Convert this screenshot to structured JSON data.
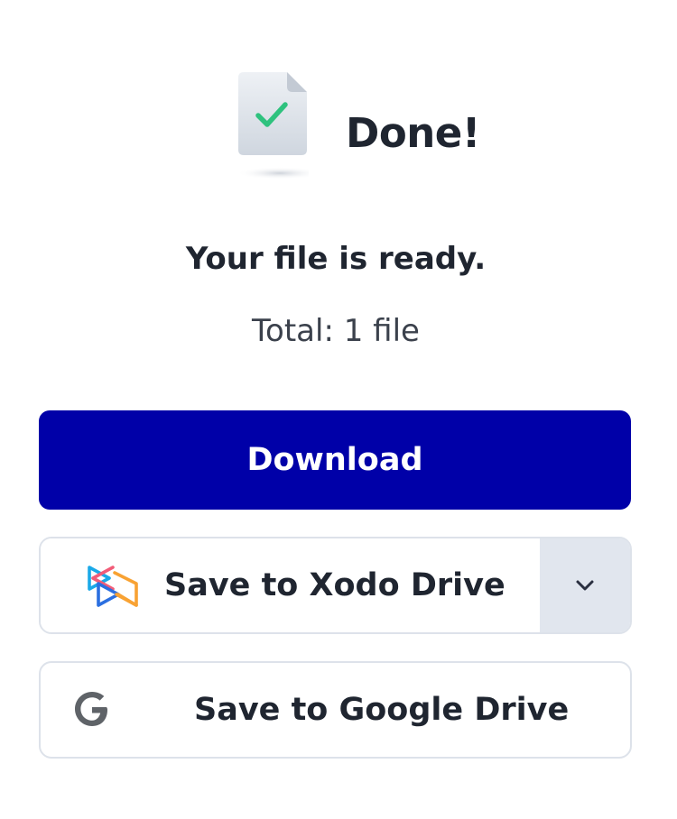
{
  "header": {
    "title": "Done!",
    "file_icon": "file-check-icon"
  },
  "status": {
    "message": "Your file is ready.",
    "total": "Total: 1 file"
  },
  "actions": {
    "download_label": "Download",
    "xodo_label": "Save to Xodo Drive",
    "xodo_icon": "xodo-drive-icon",
    "dropdown_icon": "chevron-down-icon",
    "google_label": "Save to Google Drive",
    "google_icon": "google-icon"
  },
  "colors": {
    "primary": "#0000a8",
    "check": "#2ec27e",
    "dropdown_bg": "#e1e6ee",
    "border": "#dde2ea"
  }
}
